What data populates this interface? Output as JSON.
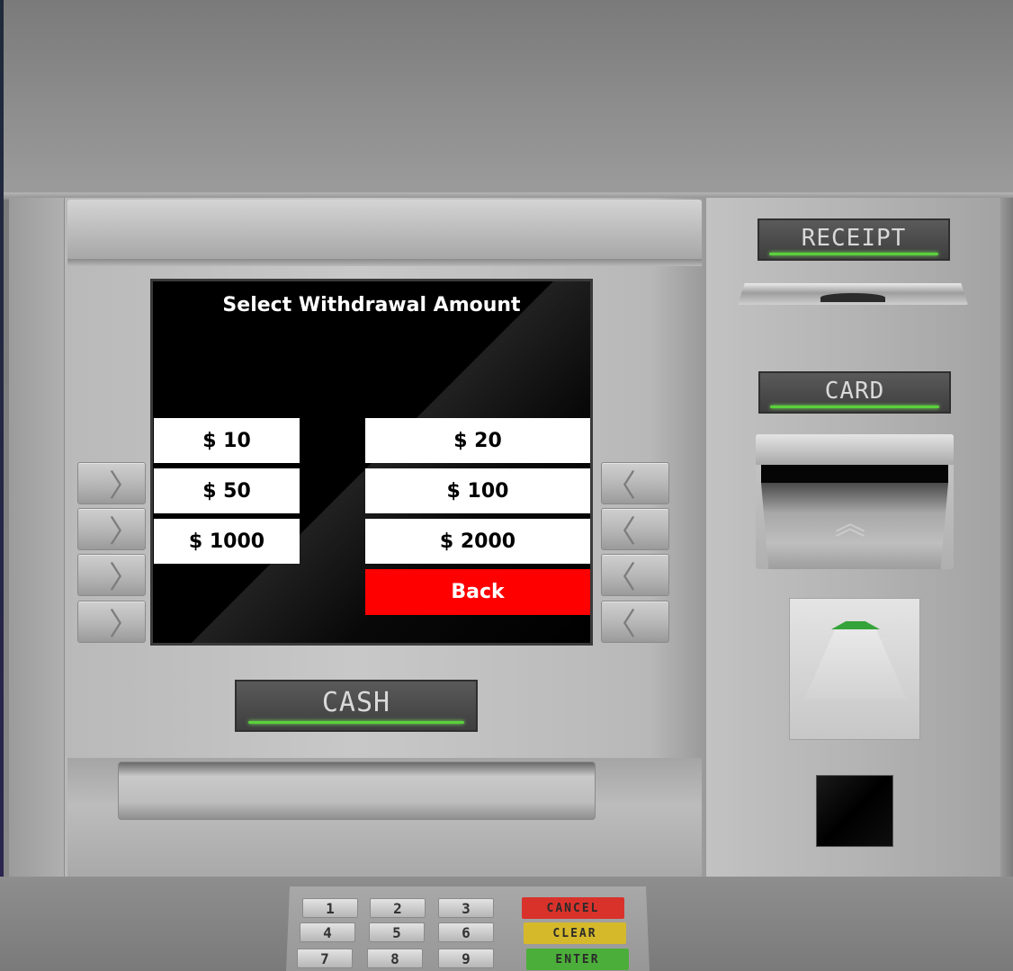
{
  "screen": {
    "title": "Select Withdrawal Amount",
    "amounts": {
      "a10": "$ 10",
      "a20": "$ 20",
      "a50": "$ 50",
      "a100": "$ 100",
      "a1000": "$ 1000",
      "a2000": "$ 2000"
    },
    "back_label": "Back"
  },
  "labels": {
    "receipt": "RECEIPT",
    "card": "CARD",
    "cash": "CASH"
  },
  "keypad": {
    "row1": [
      "1",
      "2",
      "3"
    ],
    "row2": [
      "4",
      "5",
      "6"
    ],
    "row3": [
      "7",
      "8",
      "9"
    ],
    "cancel": "CANCEL",
    "clear": "CLEAR",
    "enter": "ENTER"
  },
  "colors": {
    "back_button": "#ff0000",
    "led": "#5ad13b",
    "cancel": "#d9322b",
    "clear": "#d6b92a",
    "enter": "#4cae3a"
  },
  "icons": {
    "side_left": "chevron-right-icon",
    "side_right": "chevron-left-icon",
    "card_insert": "double-chevron-up-icon"
  }
}
